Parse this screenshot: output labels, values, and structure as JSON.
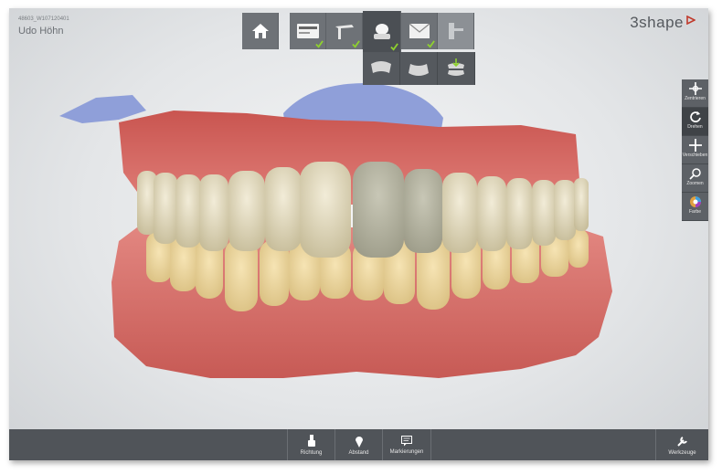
{
  "case": {
    "id": "48603_W107120401",
    "patient_name": "Udo Höhn"
  },
  "brand": {
    "name": "3shape",
    "accent": "#c0392b"
  },
  "workflow": {
    "steps": [
      {
        "name": "home",
        "icon": "home-icon",
        "checked": false
      },
      {
        "name": "order-form",
        "icon": "card-icon",
        "checked": true
      },
      {
        "name": "scan-setup",
        "icon": "scanner-arm-icon",
        "checked": true
      },
      {
        "name": "scan",
        "icon": "scan-head-icon",
        "checked": true,
        "active": true
      },
      {
        "name": "envelope",
        "icon": "envelope-icon",
        "checked": true
      },
      {
        "name": "articulator",
        "icon": "articulator-icon",
        "checked": false
      }
    ],
    "substeps": [
      {
        "name": "upper-jaw",
        "icon": "upper-jaw-icon"
      },
      {
        "name": "lower-jaw",
        "icon": "lower-jaw-icon"
      },
      {
        "name": "bite",
        "icon": "bite-icon"
      }
    ]
  },
  "view_tools": [
    {
      "label": "Zentrieren",
      "icon": "center-icon"
    },
    {
      "label": "Drehen",
      "icon": "rotate-icon"
    },
    {
      "label": "Verschieben",
      "icon": "pan-icon"
    },
    {
      "label": "Zoomen",
      "icon": "zoom-icon"
    },
    {
      "label": "Farbe",
      "icon": "color-icon"
    }
  ],
  "bottom_tools": [
    {
      "label": "Richtung",
      "icon": "direction-icon"
    },
    {
      "label": "Abstand",
      "icon": "distance-icon"
    },
    {
      "label": "Markierungen",
      "icon": "marker-icon"
    }
  ],
  "tools_button": {
    "label": "Werkzeuge",
    "icon": "wrench-icon"
  },
  "colors": {
    "toolbar": "#6e7277",
    "toolbar_active": "#4b4f54",
    "check": "#8ed12e",
    "gum": "#d9706c",
    "tooth": "#ecdcb0",
    "palate": "#8f9fd9"
  }
}
